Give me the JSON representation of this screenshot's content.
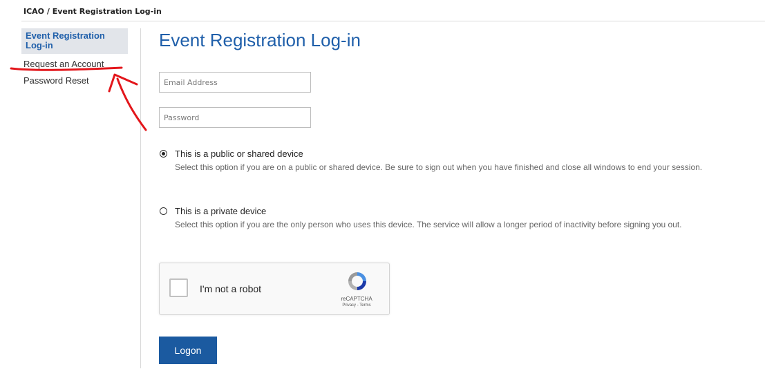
{
  "breadcrumb": "ICAO / Event Registration Log-in",
  "sidebar": {
    "active": "Event Registration Log-in",
    "items": [
      {
        "label": "Request an Account"
      },
      {
        "label": "Password Reset"
      }
    ]
  },
  "main": {
    "title": "Event Registration Log-in",
    "email_placeholder": "Email Address",
    "password_placeholder": "Password",
    "options": [
      {
        "label": "This is a public or shared device",
        "description": "Select this option if you are on a public or shared device. Be sure to sign out when you have finished and close all windows to end your session.",
        "selected": true
      },
      {
        "label": "This is a private device",
        "description": "Select this option if you are the only person who uses this device. The service will allow a longer period of inactivity before signing you out.",
        "selected": false
      }
    ],
    "captcha": {
      "label": "I'm not a robot",
      "brand": "reCAPTCHA",
      "terms": "Privacy - Terms"
    },
    "logon_label": "Logon"
  },
  "colors": {
    "accent": "#1f5faa",
    "button": "#1b5aa0",
    "annotation": "#e3161b"
  }
}
